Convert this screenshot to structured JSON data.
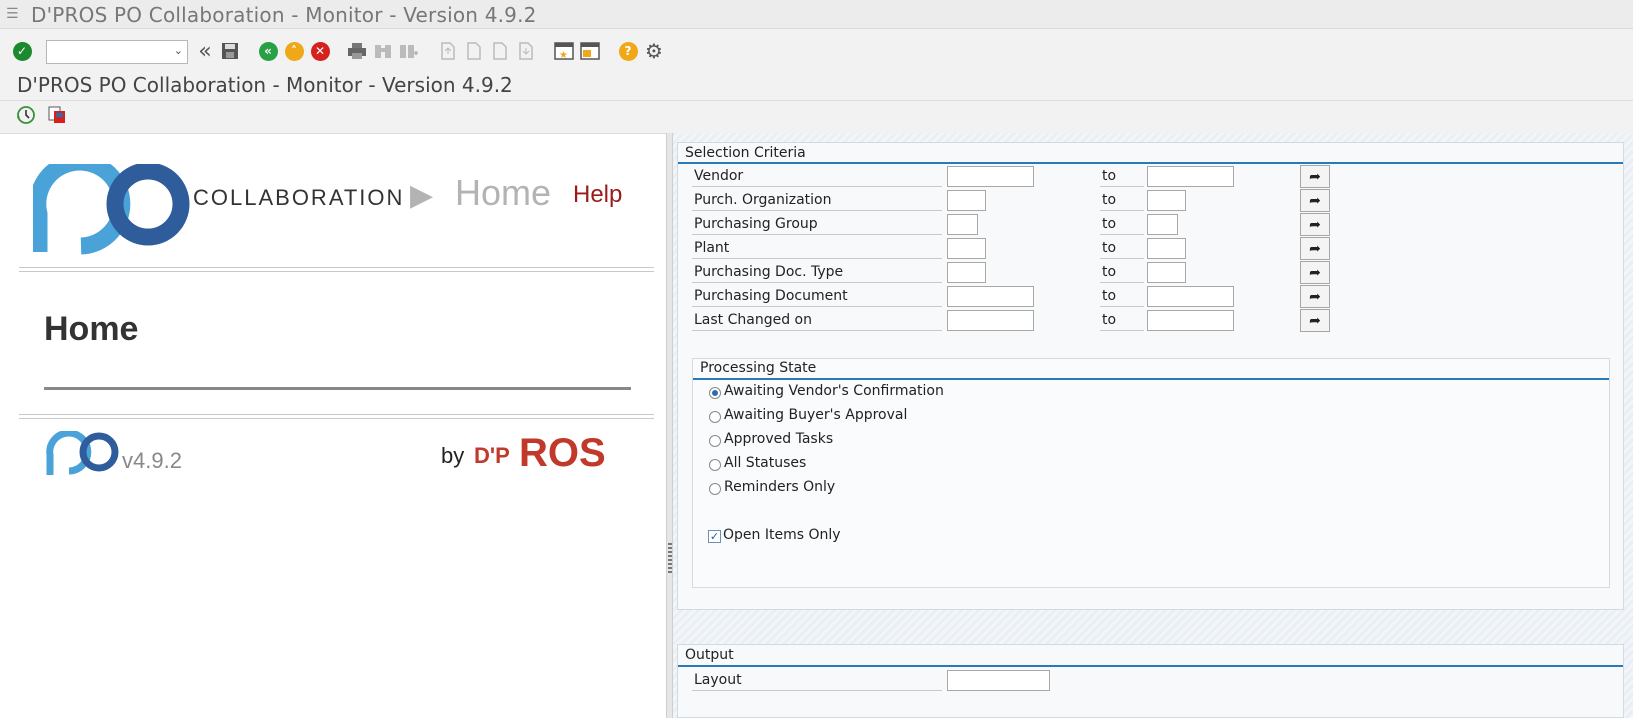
{
  "window": {
    "title": "D'PROS PO Collaboration - Monitor - Version 4.9.2"
  },
  "page": {
    "title": "D'PROS PO Collaboration - Monitor - Version 4.9.2"
  },
  "toolbar": {
    "command_value": "",
    "icons": [
      "enter-icon",
      "back-icon",
      "save-icon",
      "back-green-icon",
      "exit-icon",
      "cancel-icon",
      "print-icon",
      "find-icon",
      "find-next-icon",
      "first-page-icon",
      "previous-page-icon",
      "next-page-icon",
      "last-page-icon",
      "create-session-icon",
      "shortcut-icon",
      "help-icon",
      "customize-layout-icon"
    ]
  },
  "app_toolbar": {
    "icons": [
      "execute-icon",
      "get-variant-icon"
    ]
  },
  "home": {
    "logo_word": "COLLABORATION",
    "nav_arrow": "▶",
    "nav_home": "Home",
    "nav_help": "Help",
    "heading": "Home",
    "version": "v4.9.2",
    "by": "by",
    "brand_d": "D'P",
    "brand_ros": "ROS"
  },
  "selection": {
    "title": "Selection Criteria",
    "to_label": "to",
    "rows": [
      {
        "label": "Vendor",
        "from": "",
        "to": ""
      },
      {
        "label": "Purch. Organization",
        "from": "",
        "to": ""
      },
      {
        "label": "Purchasing Group",
        "from": "",
        "to": ""
      },
      {
        "label": "Plant",
        "from": "",
        "to": ""
      },
      {
        "label": "Purchasing Doc. Type",
        "from": "",
        "to": ""
      },
      {
        "label": "Purchasing Document",
        "from": "",
        "to": ""
      },
      {
        "label": "Last Changed on",
        "from": "",
        "to": ""
      }
    ]
  },
  "processing": {
    "title": "Processing State",
    "options": [
      {
        "label": "Awaiting Vendor's Confirmation",
        "selected": true
      },
      {
        "label": "Awaiting Buyer's Approval",
        "selected": false
      },
      {
        "label": "Approved Tasks",
        "selected": false
      },
      {
        "label": "All Statuses",
        "selected": false
      },
      {
        "label": "Reminders Only",
        "selected": false
      }
    ],
    "open_items_label": "Open Items Only",
    "open_items_checked": true
  },
  "output": {
    "title": "Output",
    "layout_label": "Layout",
    "layout_value": ""
  },
  "colors": {
    "sap_blue": "#2a7ab8",
    "logo_light": "#4aa3d8",
    "logo_dark": "#2f5d9c",
    "help_red": "#9b1b1b",
    "brand_red": "#c0392b"
  }
}
